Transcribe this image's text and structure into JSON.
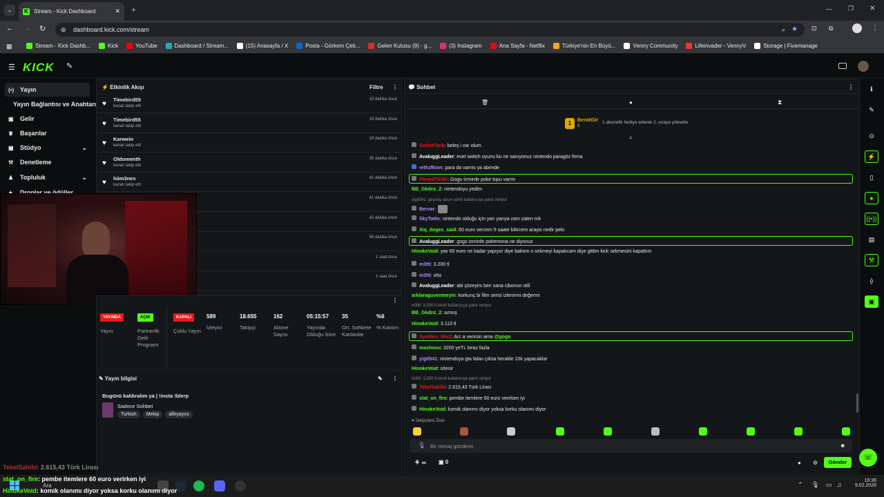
{
  "browser": {
    "tab_title": "Stream - Kick Dashboard",
    "url": "dashboard.kick.com/stream",
    "bookmarks": [
      "Stream - Kick Dashb...",
      "Kick",
      "YouTube",
      "Dashboard / Stream...",
      "(15) Anasayfa / X",
      "Posta - Görkem Çeti...",
      "Gelen Kutusu (9) - g...",
      "(3) Instagram",
      "Ana Sayfa - Netflix",
      "Türkiye'nin En Büyü...",
      "Venny Community",
      "Lifeinvader - VennyV",
      "Storage | Fivemanage"
    ]
  },
  "colors": {
    "accent": "#53fc18",
    "live_red": "#e91916"
  },
  "sidebar": {
    "items": [
      {
        "label": "Yayın",
        "icon": "broadcast-icon"
      },
      {
        "label": "Yayın Bağlantısı ve Anahtarı",
        "icon": ""
      },
      {
        "label": "Gelir",
        "icon": "money-icon"
      },
      {
        "label": "Başarılar",
        "icon": "trophy-icon"
      },
      {
        "label": "Stüdyo",
        "icon": "studio-icon"
      },
      {
        "label": "Denetleme",
        "icon": "hammer-icon"
      },
      {
        "label": "Topluluk",
        "icon": "community-icon"
      },
      {
        "label": "Droplar ve ödüller",
        "icon": "gift-icon"
      }
    ]
  },
  "activity": {
    "title": "Etkinlik Akışı",
    "filter": "Filtre",
    "rows": [
      {
        "name": "Timebird55",
        "sub": "kanalı takip etti",
        "time": "19 dakika önce"
      },
      {
        "name": "Timebird55",
        "sub": "kanalı takip etti",
        "time": "19 dakika önce"
      },
      {
        "name": "Karwein",
        "sub": "kanalı takip etti",
        "time": "19 dakika önce"
      },
      {
        "name": "Oldomenth",
        "sub": "kanalı takip etti",
        "time": "35 dakika önce"
      },
      {
        "name": "hiim3nes",
        "sub": "kanalı takip etti",
        "time": "41 dakika önce"
      },
      {
        "name": "",
        "sub": "",
        "time": "41 dakika önce"
      },
      {
        "name": "",
        "sub": "",
        "time": "42 dakika önce"
      },
      {
        "name": "",
        "sub": "",
        "time": "58 dakika önce"
      },
      {
        "name": "",
        "sub": "",
        "time": "1 saat önce"
      },
      {
        "name": "",
        "sub": "",
        "time": "1 saat önce"
      }
    ]
  },
  "stats": {
    "badges": [
      {
        "text": "YAYINDA",
        "label": "Yayın"
      },
      {
        "text": "AÇIK",
        "label": "Partnerlik Gelir Programı"
      },
      {
        "text": "KAPALI",
        "label": "Çoklu Yayın"
      }
    ],
    "items": [
      {
        "value": "589",
        "label": "İzleyici"
      },
      {
        "value": "18.655",
        "label": "Takipçi"
      },
      {
        "value": "162",
        "label": "Abone Sayısı"
      },
      {
        "value": "05:15:57",
        "label": "Yayında Olduğu Süre"
      },
      {
        "value": "35",
        "label": "Ort. Sohbete Katılanlar"
      },
      {
        "value": "%6",
        "label": "% Katılım"
      }
    ]
  },
  "stream_info": {
    "title": "Yayın bilgisi",
    "stream_title": "Bugünü kaldıralım ya | !insta !blerp",
    "category": "Sadece Sohbet",
    "tags": [
      "Turkish",
      "Mekip",
      "alleyayını"
    ]
  },
  "chat": {
    "title": "Sohbet",
    "pinned_user": "BeratGlr",
    "pinned_text": "1 abonelik hediye ederek 2. sıraya yükselin",
    "pinned_level": "5",
    "messages": [
      {
        "user": "GofretTank",
        "color": "#e91916",
        "text": ": beleş i var olum",
        "hl": false
      },
      {
        "user": "AvaluggLeader",
        "color": "#ffffff",
        "text": ": evet switch oyunu bu ne sanıyonuz nintendo paragöz firma",
        "hl": false
      },
      {
        "user": "rethzfkinn",
        "color": "#b388ff",
        "text": ": para da varnis ya abimde",
        "hl": false
      },
      {
        "user": "FlexedTANK",
        "color": "#e91916",
        "text": ": Gogo İzmirde poke topu varmi",
        "hl": true
      },
      {
        "user": "BB_Gkdnz_2",
        "color": "#53fc18",
        "text": ": nintendoyu yedim",
        "hl": false
      },
      {
        "user": "Bervar",
        "color": "#b388ff",
        "text": ":",
        "hl": false
      },
      {
        "user": "SkyTw0o",
        "color": "#b388ff",
        "text": ": nintendo olduğu için yarı yarıya zam zaten mk",
        "hl": false
      },
      {
        "user": "Xiq_dogex_said",
        "color": "#53fc18",
        "text": ": 60 euro vercem 5 saate bitircem arayis nedir peki",
        "hl": false
      },
      {
        "user": "AvaluggLeader",
        "color": "#ffffff",
        "text": ": gogo izmirde pokemona ne diyonuz",
        "hl": true
      },
      {
        "user": "HinokeVoid",
        "color": "#53fc18",
        "text": ": yav 60 euro ne kadar yapıyor diye baktım o sekmeyi kapatıcam diye gittim kick sekmesini kapattım",
        "hl": false
      },
      {
        "user": "m3tti",
        "color": "#b388ff",
        "text": ": 3.200 tl",
        "hl": false
      },
      {
        "user": "m3tti",
        "color": "#b388ff",
        "text": ": oho",
        "hl": false
      },
      {
        "user": "AvaluggLeader",
        "color": "#ffffff",
        "text": ": abi çözeyim ben sana cibonun stili",
        "hl": false
      },
      {
        "user": "arklaraguvenmeyin",
        "color": "#53fc18",
        "text": ": korkunç bi film serisi izlenirmi değermi",
        "hl": false
      },
      {
        "user": "BB_Gkdnz_2",
        "color": "#53fc18",
        "text": ": azmış",
        "hl": false
      },
      {
        "user": "HinokeVoid",
        "color": "#53fc18",
        "text": ": 3.113 tl",
        "hl": false
      },
      {
        "user": "Symbox_56v2",
        "color": "#e91916",
        "text": ": Arc a verirsin ama ",
        "mention": "@gogo",
        "hl": true
      },
      {
        "user": "mashouu",
        "color": "#53fc18",
        "text": ": 3200 yeTL biraz fazla",
        "hl": false
      },
      {
        "user": "yigit541",
        "color": "#b388ff",
        "text": ": nintendoya gta falan çıksa heralde 10k yapacaklar",
        "hl": false
      },
      {
        "user": "HinokeVoid",
        "color": "#53fc18",
        "text": ": izlenir",
        "hl": false
      },
      {
        "user": "TekelSahibi",
        "color": "#e91916",
        "text": ": 2.615,43 Türk Lirası",
        "hl": false
      },
      {
        "user": "stat_on_fire",
        "color": "#53fc18",
        "text": ": pembe itemlere 60 euro verirken iyi",
        "hl": false
      },
      {
        "user": "HinokeVoid",
        "color": "#53fc18",
        "text": ": komik olanımı diyor yoksa korku olanımı diyor",
        "hl": false
      }
    ],
    "replies": [
      "yigit541: geçmiş olsun isimli kullanıcıya yanıt veriyor",
      "m3tti: 3.200 tl isimli kullanıcıya yanıt veriyor",
      "m3tti: 3.200 tl isimli kullanıcıya yanıt veriyor"
    ],
    "emote_label": "Takipçilere Özel",
    "placeholder": "Bir mesaj gönderin",
    "send": "Gönder",
    "points": "∞",
    "count": "0"
  },
  "overlay": {
    "line1_user": "TekelSahibi",
    "line1_text": ": 2.615,43 Türk Lirası",
    "line2_user": "stat_on_fire",
    "line2_text": ": pembe itemlere 60 euro verirken iyi",
    "line3_user": "HinokeVoid",
    "line3_text": ": komik olanımı diyor yoksa korku olanımı diyor"
  },
  "taskbar": {
    "search": "Ara",
    "time": "19:36",
    "date": "9.02.2026"
  }
}
